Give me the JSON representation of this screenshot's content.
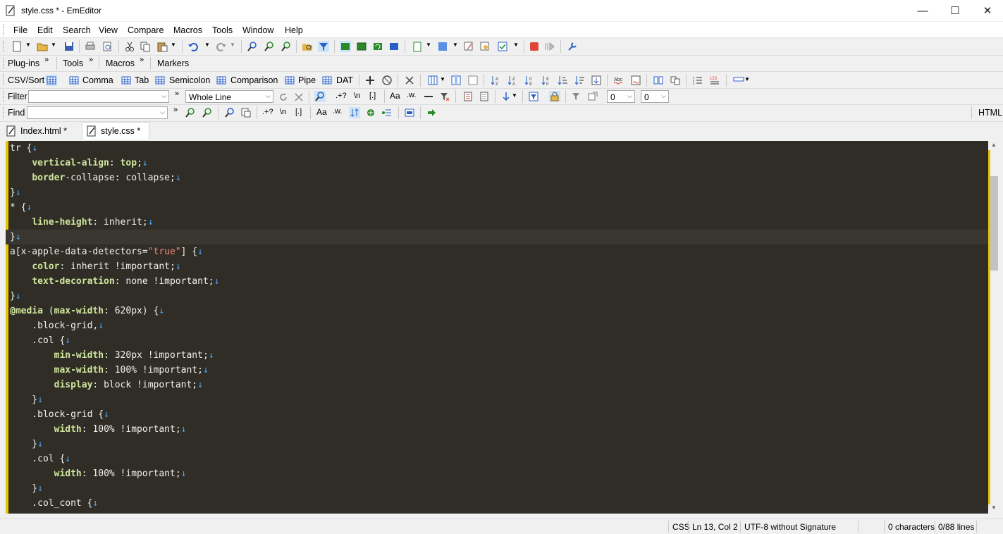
{
  "window": {
    "title": "style.css * - EmEditor",
    "minimize": "—",
    "maximize": "☐",
    "close": "✕"
  },
  "menu": [
    "File",
    "Edit",
    "Search",
    "View",
    "Compare",
    "Macros",
    "Tools",
    "Window",
    "Help"
  ],
  "bars": {
    "plugins": "Plug-ins",
    "tools": "Tools",
    "macros": "Macros",
    "markers": "Markers",
    "more": "»"
  },
  "csv": {
    "label": "CSV/Sort",
    "comma": "Comma",
    "tab": "Tab",
    "semicolon": "Semicolon",
    "comparison": "Comparison",
    "pipe": "Pipe",
    "dat": "DAT"
  },
  "filter": {
    "label": "Filter",
    "value": "",
    "scope": "Whole Line",
    "regex": ".+?",
    "escape": "\\n",
    "brackets": "[.]",
    "count1": "0",
    "count2": "0"
  },
  "find": {
    "label": "Find",
    "value": "",
    "regex": ".+?",
    "escape": "\\n",
    "brackets": "[.]",
    "mode": "HTML"
  },
  "tabs": [
    {
      "label": "Index.html *",
      "active": false
    },
    {
      "label": "style.css *",
      "active": true
    }
  ],
  "code_lines": [
    [
      [
        "p",
        "tr {"
      ],
      [
        "r",
        "↓"
      ]
    ],
    [
      [
        "p",
        "    "
      ],
      [
        "k",
        "vertical-align"
      ],
      [
        "p",
        ": "
      ],
      [
        "k",
        "top"
      ],
      [
        "p",
        ";"
      ],
      [
        "r",
        "↓"
      ]
    ],
    [
      [
        "p",
        "    "
      ],
      [
        "k",
        "border"
      ],
      [
        "p",
        "-collapse: collapse;"
      ],
      [
        "r",
        "↓"
      ]
    ],
    [
      [
        "p",
        "}"
      ],
      [
        "r",
        "↓"
      ]
    ],
    [
      [
        "p",
        "* {"
      ],
      [
        "r",
        "↓"
      ]
    ],
    [
      [
        "p",
        "    "
      ],
      [
        "k",
        "line-height"
      ],
      [
        "p",
        ": inherit;"
      ],
      [
        "r",
        "↓"
      ]
    ],
    [
      [
        "p",
        "}"
      ],
      [
        "r",
        "↓"
      ]
    ],
    [
      [
        "p",
        "a[x-apple-data-detectors="
      ],
      [
        "s",
        "\"true\""
      ],
      [
        "p",
        "] {"
      ],
      [
        "r",
        "↓"
      ]
    ],
    [
      [
        "p",
        "    "
      ],
      [
        "k",
        "color"
      ],
      [
        "p",
        ": inherit !important;"
      ],
      [
        "r",
        "↓"
      ]
    ],
    [
      [
        "p",
        "    "
      ],
      [
        "k",
        "text-decoration"
      ],
      [
        "p",
        ": none !important;"
      ],
      [
        "r",
        "↓"
      ]
    ],
    [
      [
        "p",
        "}"
      ],
      [
        "r",
        "↓"
      ]
    ],
    [
      [
        "k",
        "@media"
      ],
      [
        "p",
        " ("
      ],
      [
        "k",
        "max-width"
      ],
      [
        "p",
        ": 620px) {"
      ],
      [
        "r",
        "↓"
      ]
    ],
    [
      [
        "p",
        "    .block-grid,"
      ],
      [
        "r",
        "↓"
      ]
    ],
    [
      [
        "p",
        "    .col {"
      ],
      [
        "r",
        "↓"
      ]
    ],
    [
      [
        "p",
        "        "
      ],
      [
        "k",
        "min-width"
      ],
      [
        "p",
        ": 320px !important;"
      ],
      [
        "r",
        "↓"
      ]
    ],
    [
      [
        "p",
        "        "
      ],
      [
        "k",
        "max-width"
      ],
      [
        "p",
        ": 100% !important;"
      ],
      [
        "r",
        "↓"
      ]
    ],
    [
      [
        "p",
        "        "
      ],
      [
        "k",
        "display"
      ],
      [
        "p",
        ": block !important;"
      ],
      [
        "r",
        "↓"
      ]
    ],
    [
      [
        "p",
        "    }"
      ],
      [
        "r",
        "↓"
      ]
    ],
    [
      [
        "p",
        "    .block-grid {"
      ],
      [
        "r",
        "↓"
      ]
    ],
    [
      [
        "p",
        "        "
      ],
      [
        "k",
        "width"
      ],
      [
        "p",
        ": 100% !important;"
      ],
      [
        "r",
        "↓"
      ]
    ],
    [
      [
        "p",
        "    }"
      ],
      [
        "r",
        "↓"
      ]
    ],
    [
      [
        "p",
        "    .col {"
      ],
      [
        "r",
        "↓"
      ]
    ],
    [
      [
        "p",
        "        "
      ],
      [
        "k",
        "width"
      ],
      [
        "p",
        ": 100% !important;"
      ],
      [
        "r",
        "↓"
      ]
    ],
    [
      [
        "p",
        "    }"
      ],
      [
        "r",
        "↓"
      ]
    ],
    [
      [
        "p",
        "    .col_cont {"
      ],
      [
        "r",
        "↓"
      ]
    ]
  ],
  "status": {
    "language": "CSS",
    "position": "Ln 13, Col 2",
    "encoding": "UTF-8 without Signature",
    "characters": "0 characters",
    "lines": "0/88 lines"
  },
  "colors": {
    "editor_bg": "#302d26",
    "keyword": "#cfe69e",
    "string": "#f28a7c",
    "newline_mark": "#4aa7ff",
    "margin": "#e8c300"
  }
}
